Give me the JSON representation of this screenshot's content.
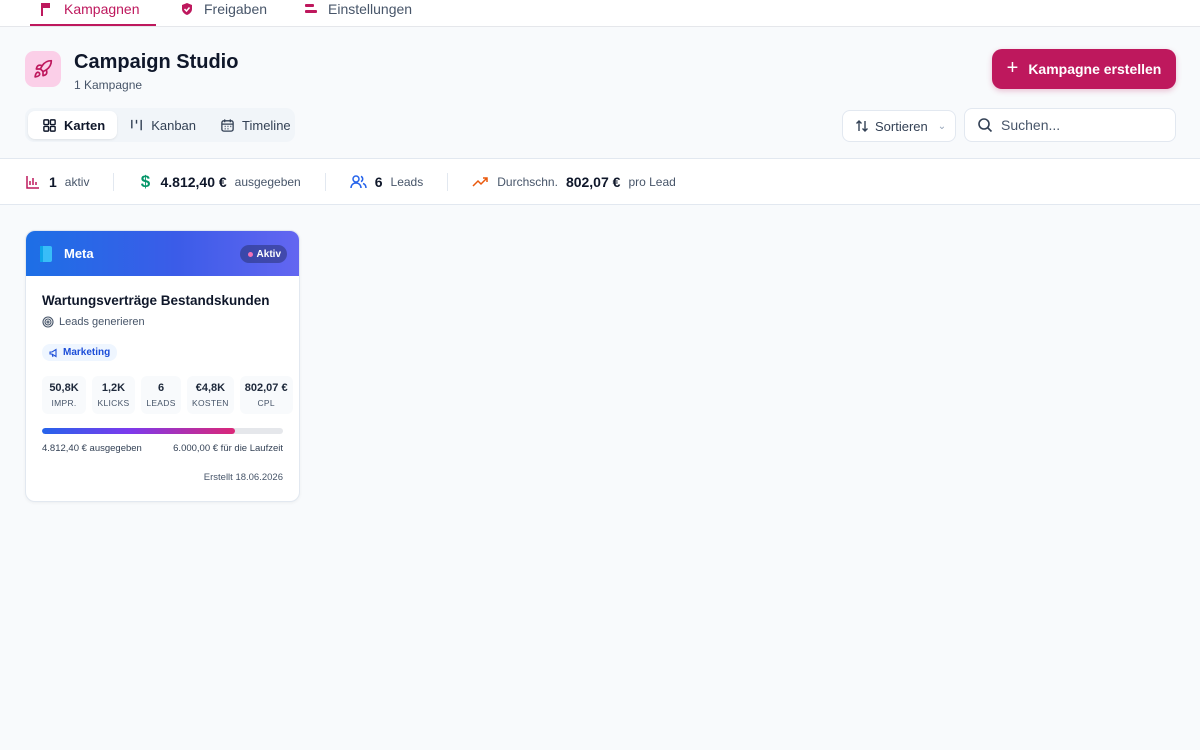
{
  "topnav": {
    "tabs": [
      {
        "label": "Kampagnen",
        "active": true
      },
      {
        "label": "Freigaben",
        "active": false
      },
      {
        "label": "Einstellungen",
        "active": false
      }
    ]
  },
  "header": {
    "title": "Campaign Studio",
    "subtitle": "1 Kampagne",
    "create_label": "Kampagne erstellen"
  },
  "views": {
    "items": [
      {
        "label": "Karten",
        "active": true,
        "icon": "grid-icon"
      },
      {
        "label": "Kanban",
        "active": false,
        "icon": "kanban-icon"
      },
      {
        "label": "Timeline",
        "active": false,
        "icon": "calendar-icon"
      }
    ]
  },
  "sort": {
    "label": "Sortieren"
  },
  "search": {
    "placeholder": "Suchen..."
  },
  "stats": {
    "active": {
      "value": "1",
      "label": "aktiv"
    },
    "spent": {
      "value": "4.812,40 €",
      "label": "ausgegeben"
    },
    "leads": {
      "value": "6",
      "label": "Leads"
    },
    "avg": {
      "prefix": "Durchschn.",
      "value": "802,07 €",
      "label": "pro Lead"
    }
  },
  "campaign": {
    "platform": "Meta",
    "status": "Aktiv",
    "title": "Wartungsverträge Bestandskunden",
    "goal": "Leads generieren",
    "tag": "Marketing",
    "metrics": [
      {
        "value": "50,8K",
        "label": "IMPR."
      },
      {
        "value": "1,2K",
        "label": "KLICKS"
      },
      {
        "value": "6",
        "label": "LEADS"
      },
      {
        "value": "€4,8K",
        "label": "KOSTEN"
      },
      {
        "value": "802,07 €",
        "label": "CPL"
      }
    ],
    "budget_progress": 0.802,
    "spent_text": "4.812,40 € ausgegeben",
    "budget_text": "6.000,00 € für die Laufzeit",
    "created_text": "Erstellt 18.06.2026"
  },
  "colors": {
    "accent": "#be185d",
    "header_gradient_start": "#1d6fe6",
    "header_gradient_end": "#6366f1"
  }
}
